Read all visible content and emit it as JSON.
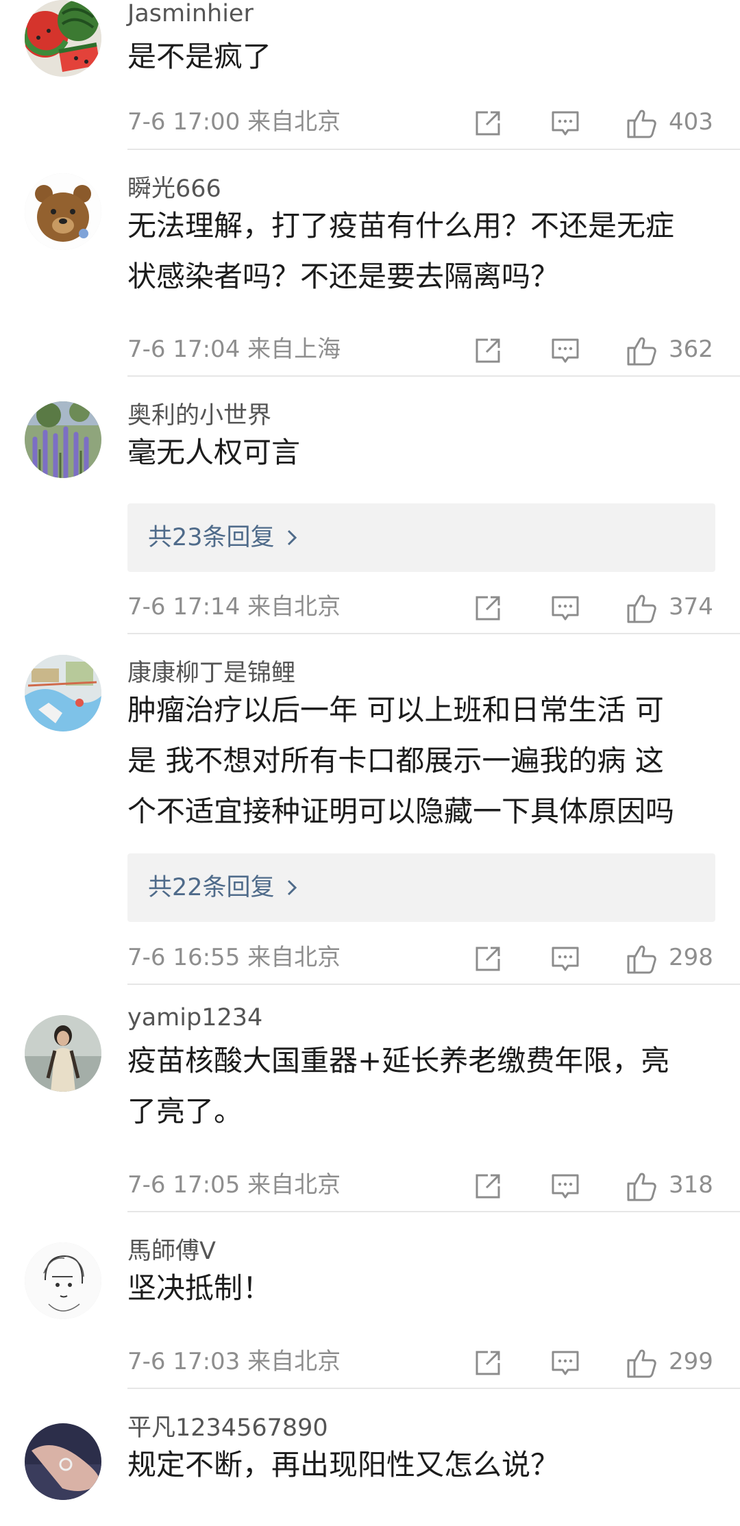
{
  "comments": [
    {
      "username": "Jasminhier",
      "lines": [
        "是不是疯了"
      ],
      "time": "7-6 17:00",
      "location": "来自北京",
      "likes": "403",
      "avatar": "watermelon"
    },
    {
      "username": "瞬光666",
      "lines": [
        "无法理解，打了疫苗有什么用？不还是无症",
        "状感染者吗？不还是要去隔离吗？"
      ],
      "time": "7-6 17:04",
      "location": "来自上海",
      "likes": "362",
      "avatar": "bear"
    },
    {
      "username": "奥利的小世界",
      "lines": [
        "毫无人权可言"
      ],
      "replies": "共23条回复",
      "time": "7-6 17:14",
      "location": "来自北京",
      "likes": "374",
      "avatar": "lavender"
    },
    {
      "username": "康康柳丁是锦鲤",
      "lines": [
        "肿瘤治疗以后一年 可以上班和日常生活 可",
        "是 我不想对所有卡口都展示一遍我的病 这",
        "个不适宜接种证明可以隐藏一下具体原因吗"
      ],
      "replies": "共22条回复",
      "time": "7-6 16:55",
      "location": "来自北京",
      "likes": "298",
      "avatar": "map"
    },
    {
      "username": "yamip1234",
      "lines": [
        "疫苗核酸大国重器+延长养老缴费年限，亮",
        "了亮了。"
      ],
      "time": "7-6 17:05",
      "location": "来自北京",
      "likes": "318",
      "avatar": "person"
    },
    {
      "username": "馬師傅V",
      "lines": [
        "坚决抵制！"
      ],
      "time": "7-6 17:03",
      "location": "来自北京",
      "likes": "299",
      "avatar": "sketch"
    },
    {
      "username": "平凡1234567890",
      "lines": [
        "规定不断，再出现阳性又怎么说？"
      ],
      "avatar": "hand"
    }
  ]
}
